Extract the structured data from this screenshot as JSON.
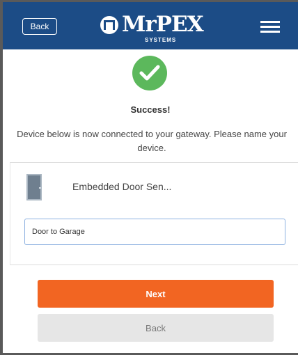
{
  "header": {
    "back_label": "Back",
    "logo_text": "MrPEX",
    "logo_sub": "SYSTEMS",
    "bg_color": "#1c4c86"
  },
  "status": {
    "icon": "check-icon",
    "title": "Success!",
    "message": "Device below is now connected to your gateway. Please name your device."
  },
  "device": {
    "icon": "door-sensor-icon",
    "name": "Embedded Door Sen..."
  },
  "name_field": {
    "value": "Door to Garage"
  },
  "actions": {
    "next_label": "Next",
    "back_label": "Back"
  },
  "colors": {
    "accent": "#f26522",
    "success": "#5cb85c"
  }
}
